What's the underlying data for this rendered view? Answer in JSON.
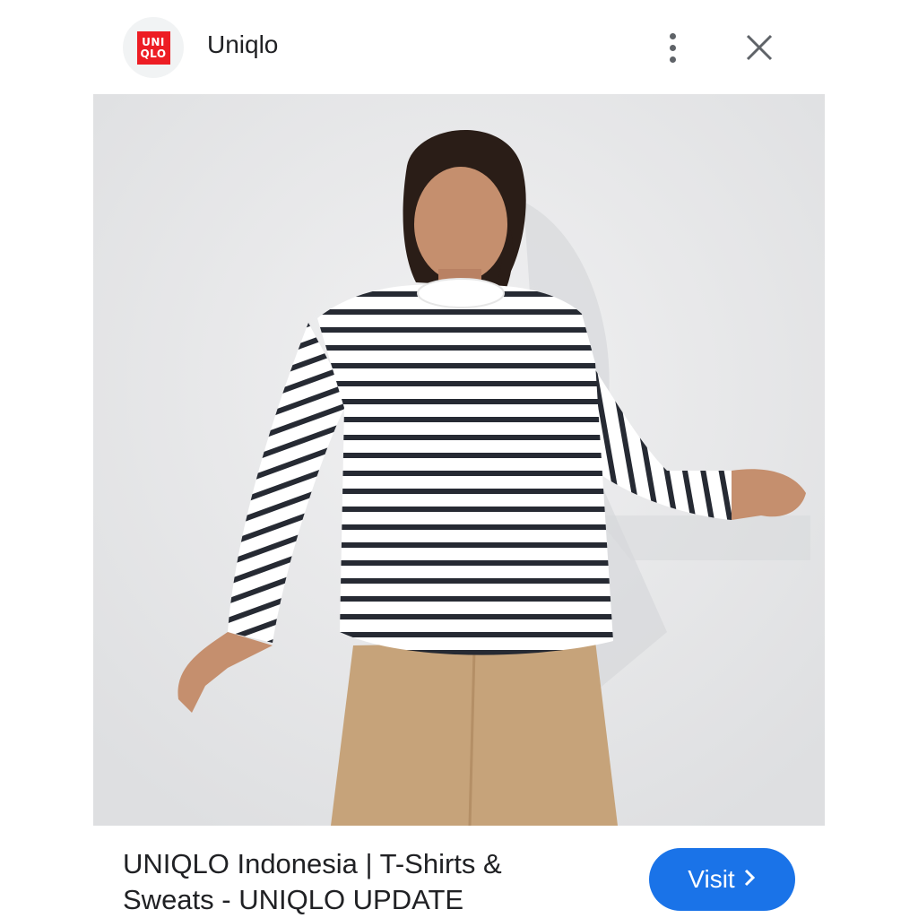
{
  "header": {
    "logo_text": [
      "UNI",
      "QLO"
    ],
    "site_name": "Uniqlo",
    "more_icon": "more-vert-icon",
    "close_icon": "close-icon"
  },
  "image": {
    "alt": "Model wearing striped long-sleeve T-shirt and beige trousers"
  },
  "footer": {
    "caption_line1": "UNIQLO Indonesia | T-Shirts &",
    "caption_line2": "Sweats - UNIQLO UPDATE",
    "visit_label": "Visit",
    "visit_icon": "chevron-right-icon"
  },
  "colors": {
    "accent": "#1a73e8",
    "brand": "#ed1d24"
  }
}
